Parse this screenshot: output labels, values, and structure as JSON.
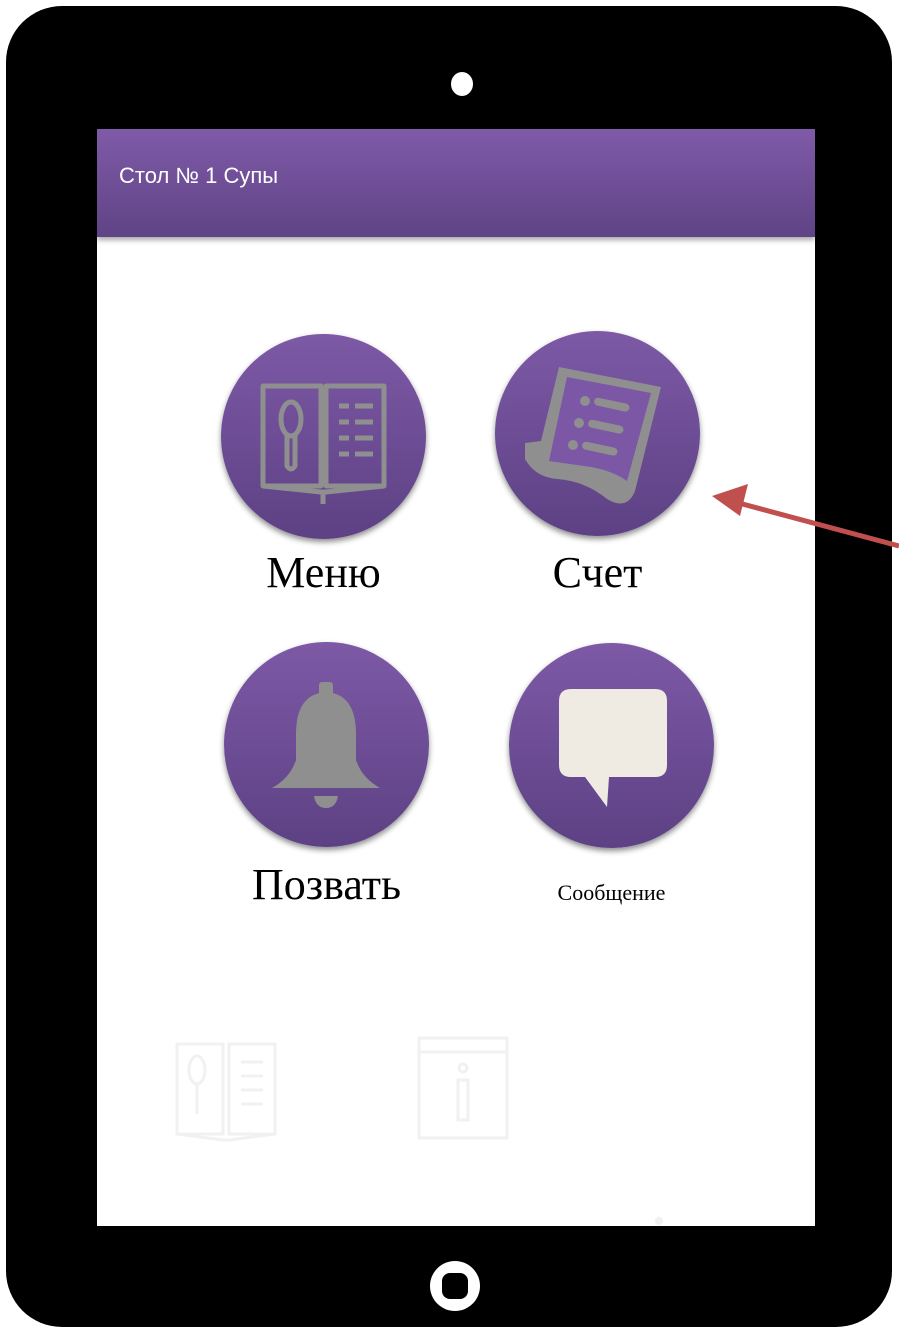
{
  "app_bar": {
    "title": "Стол № 1 Супы"
  },
  "tiles": {
    "menu": {
      "label": "Меню",
      "icon": "menu-book-icon"
    },
    "bill": {
      "label": "Счет",
      "icon": "receipt-icon"
    },
    "call": {
      "label": "Позвать",
      "icon": "bell-icon"
    },
    "message": {
      "label": "Сообщение",
      "icon": "speech-bubble-icon"
    }
  },
  "bottom_nav": {
    "icons": [
      "menu-book-icon",
      "info-icon",
      "dot-icon"
    ]
  },
  "colors": {
    "accent": "#7b57a5",
    "accent_dark": "#5d4184",
    "icon_gray": "#8f8f8f",
    "bubble": "#efebe2",
    "arrow": "#c0504d"
  }
}
